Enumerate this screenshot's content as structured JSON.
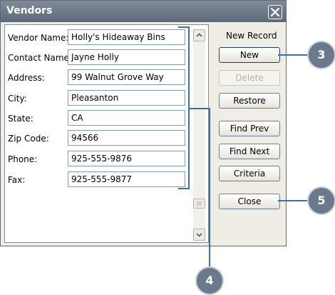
{
  "window": {
    "title": "Vendors"
  },
  "fields": [
    {
      "label": "Vendor Name:",
      "value": "Holly's Hideaway Bins"
    },
    {
      "label": "Contact Name:",
      "value": "Jayne Holly"
    },
    {
      "label": "Address:",
      "value": "99 Walnut Grove Way"
    },
    {
      "label": "City:",
      "value": "Pleasanton"
    },
    {
      "label": "State:",
      "value": "CA"
    },
    {
      "label": "Zip Code:",
      "value": "94566"
    },
    {
      "label": "Phone:",
      "value": "925-555-9876"
    },
    {
      "label": "Fax:",
      "value": "925-555-9877"
    }
  ],
  "status": {
    "new_record": "New Record"
  },
  "buttons": {
    "new": "New",
    "delete": "Delete",
    "restore": "Restore",
    "find_prev": "Find Prev",
    "find_next": "Find Next",
    "criteria": "Criteria",
    "close": "Close"
  },
  "callouts": {
    "c3": "3",
    "c4": "4",
    "c5": "5"
  },
  "colors": {
    "callout_line": "#3b6fb3",
    "badge": "#6a7a8b",
    "title_bar": "#6c7888"
  }
}
